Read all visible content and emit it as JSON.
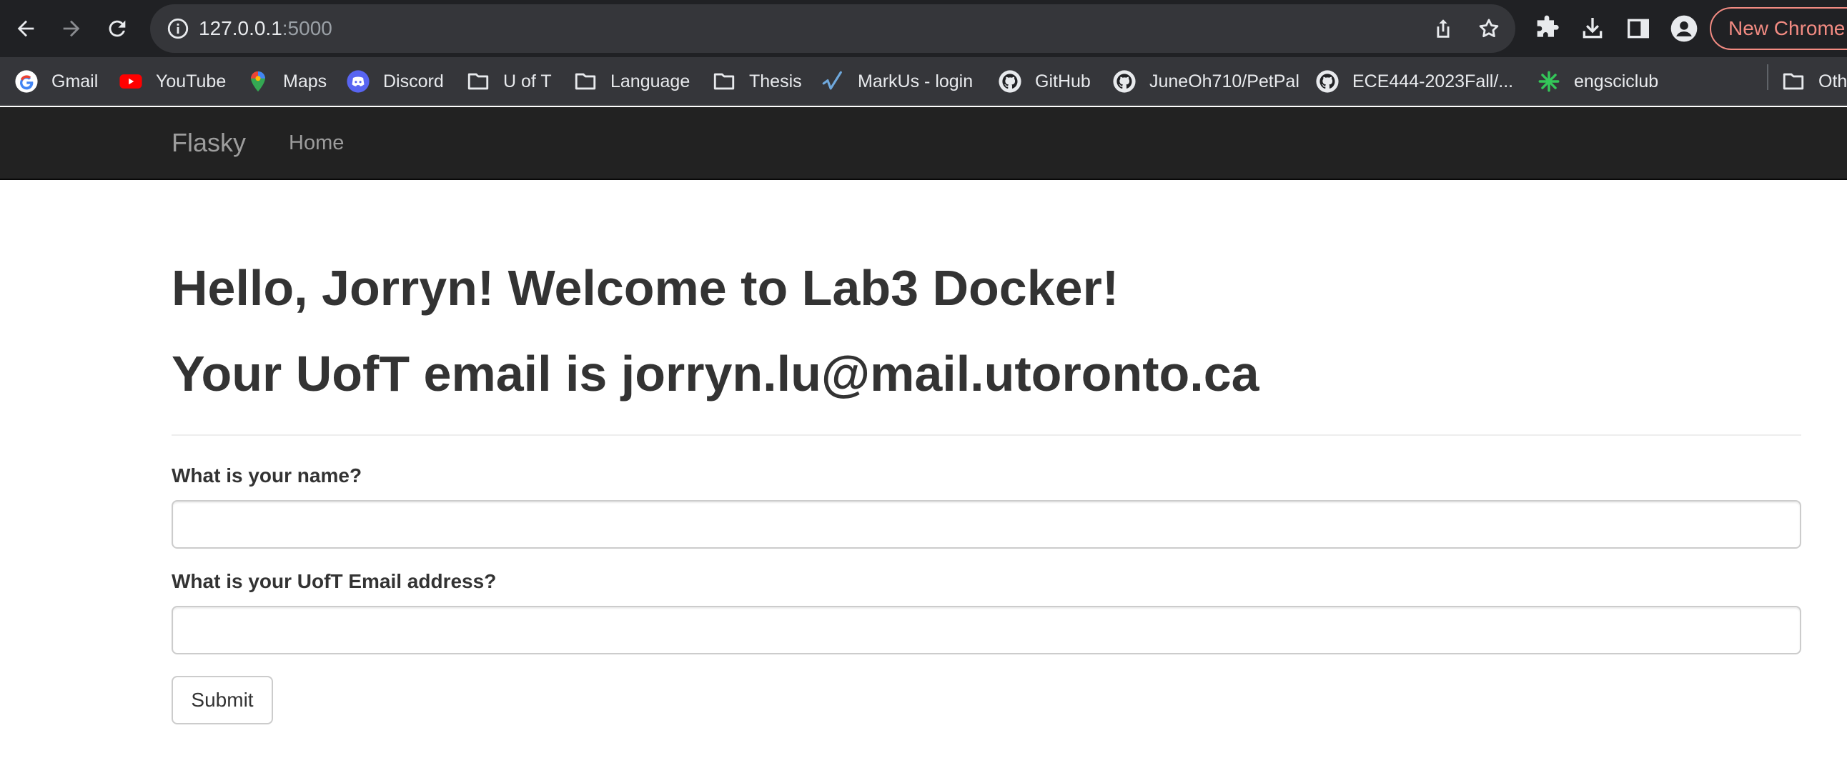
{
  "browser": {
    "url_host": "127.0.0.1",
    "url_port": ":5000",
    "new_chrome_label": "New Chrome",
    "bookmarks": [
      {
        "label": "Gmail",
        "icon": "google-icon"
      },
      {
        "label": "YouTube",
        "icon": "youtube-icon"
      },
      {
        "label": "Maps",
        "icon": "maps-icon"
      },
      {
        "label": "Discord",
        "icon": "discord-icon"
      },
      {
        "label": "U of T",
        "icon": "folder-icon"
      },
      {
        "label": "Language",
        "icon": "folder-icon"
      },
      {
        "label": "Thesis",
        "icon": "folder-icon"
      },
      {
        "label": "MarkUs - login",
        "icon": "markus-icon"
      },
      {
        "label": "GitHub",
        "icon": "github-icon"
      },
      {
        "label": "JuneOh710/PetPal",
        "icon": "github-icon"
      },
      {
        "label": "ECE444-2023Fall/...",
        "icon": "github-icon"
      },
      {
        "label": "engsciclub",
        "icon": "engsciclub-icon"
      },
      {
        "label": "Oth",
        "icon": "folder-icon"
      }
    ]
  },
  "navbar": {
    "brand": "Flasky",
    "home": "Home"
  },
  "page": {
    "greeting": "Hello, Jorryn! Welcome to Lab3 Docker!",
    "email_line": "Your UofT email is jorryn.lu@mail.utoronto.ca",
    "form": {
      "name_label": "What is your name?",
      "name_value": "",
      "email_label": "What is your UofT Email address?",
      "email_value": "",
      "submit_label": "Submit"
    }
  },
  "colors": {
    "chrome_bg": "#202124",
    "bookmarks_bg": "#35363a",
    "navbar_bg": "#222222",
    "navbar_text": "#9d9d9d",
    "heading_text": "#333333",
    "new_chrome_accent": "#f28b82"
  }
}
